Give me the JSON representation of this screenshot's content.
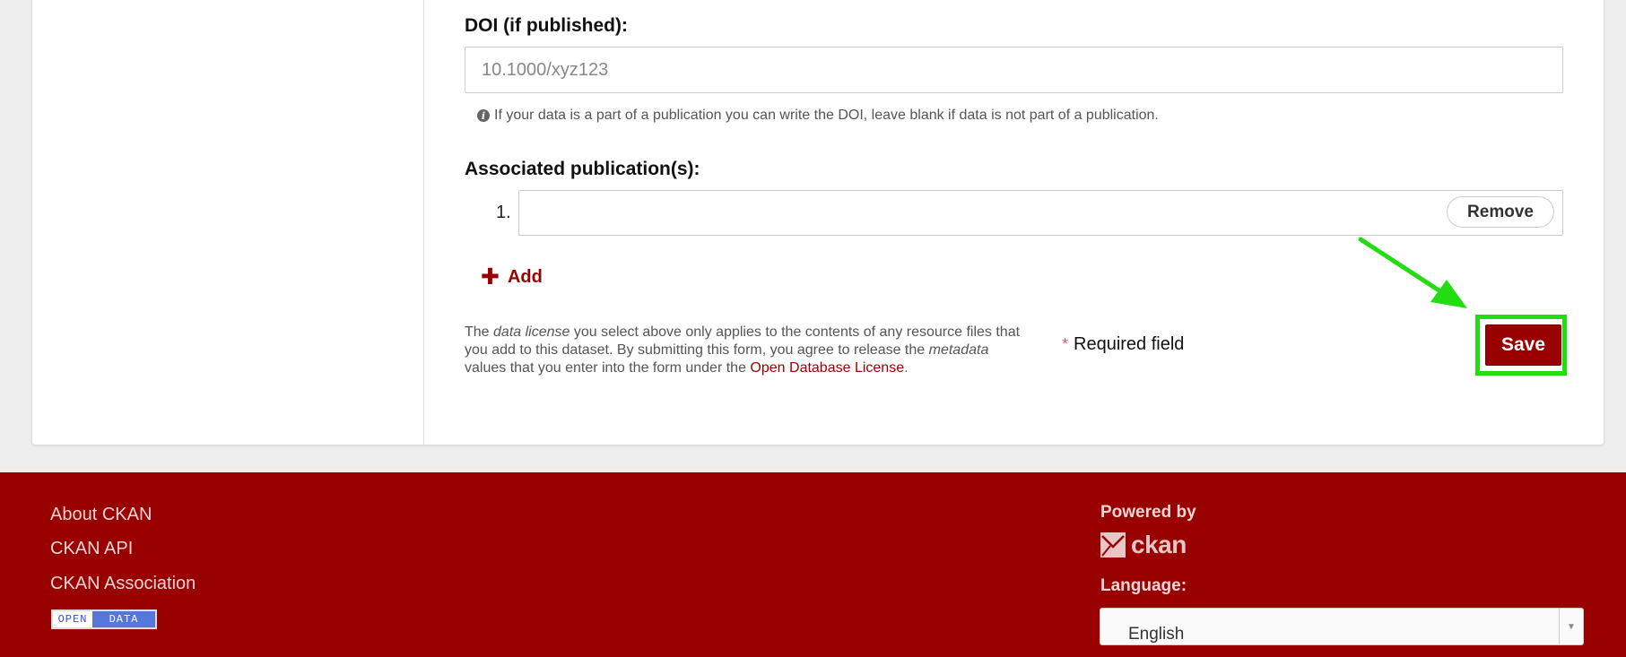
{
  "form": {
    "doi": {
      "label": "DOI (if published):",
      "placeholder": "10.1000/xyz123",
      "value": "",
      "help_text": "If your data is a part of a publication you can write the DOI, leave blank if data is not part of a publication."
    },
    "publications": {
      "label": "Associated publication(s):",
      "items": [
        {
          "number": "1.",
          "value": "",
          "remove_label": "Remove"
        }
      ],
      "add_label": "Add"
    },
    "license_note": {
      "part1": "The ",
      "em1": "data license",
      "part2": " you select above only applies to the contents of any resource files that you add to this dataset. By submitting this form, you agree to release the ",
      "em2": "metadata",
      "part3": " values that you enter into the form under the ",
      "link": "Open Database License",
      "part4": "."
    },
    "required": {
      "star": "*",
      "text": "Required field"
    },
    "save_label": "Save"
  },
  "annotation": {
    "highlight_color": "#22dd11"
  },
  "footer": {
    "links": [
      "About CKAN",
      "CKAN API",
      "CKAN Association"
    ],
    "badge": {
      "left": "OPEN",
      "right": "DATA"
    },
    "powered_by": "Powered by",
    "logo_text": "ckan",
    "language_label": "Language:",
    "language_value": "English"
  },
  "colors": {
    "brand": "#990000",
    "page_bg": "#eeeeee",
    "highlight": "#22dd11"
  }
}
